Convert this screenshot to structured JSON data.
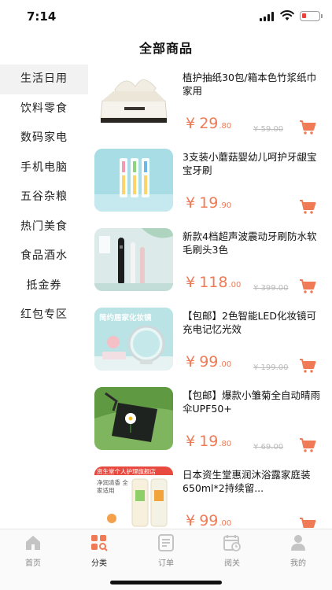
{
  "status_bar": {
    "time": "7:14",
    "battery_color": "#e8423f"
  },
  "nav": {
    "title": "全部商品"
  },
  "sidebar": {
    "items": [
      {
        "label": "生活日用",
        "active": true
      },
      {
        "label": "饮料零食"
      },
      {
        "label": "数码家电"
      },
      {
        "label": "手机电脑"
      },
      {
        "label": "五谷杂粮"
      },
      {
        "label": "热门美食"
      },
      {
        "label": "食品酒水"
      },
      {
        "label": "抵金券"
      },
      {
        "label": "红包专区"
      }
    ]
  },
  "products": [
    {
      "name": "植护抽纸30包/箱本色竹浆纸巾家用",
      "price_symbol": "¥",
      "price_int": "29",
      "price_dec": ".80",
      "old_price": "¥ 59.00",
      "image": "tissue-box-image"
    },
    {
      "name": "3支装小蘑菇婴幼儿呵护牙龈宝宝牙刷",
      "price_symbol": "¥",
      "price_int": "19",
      "price_dec": ".90",
      "old_price": "",
      "image": "baby-toothbrush-image"
    },
    {
      "name": "新款4档超声波震动牙刷防水软毛刷头3色",
      "price_symbol": "¥",
      "price_int": "118",
      "price_dec": ".00",
      "old_price": "¥ 399.00",
      "image": "electric-toothbrush-image"
    },
    {
      "name": "【包邮】2色智能LED化妆镜可充电记忆光效",
      "price_symbol": "¥",
      "price_int": "99",
      "price_dec": ".00",
      "old_price": "¥ 199.00",
      "image": "led-mirror-image",
      "thumb_caption": "简约居家化妆镜"
    },
    {
      "name": "【包邮】爆款小雏菊全自动晴雨伞UPF50+",
      "price_symbol": "¥",
      "price_int": "19",
      "price_dec": ".80",
      "old_price": "¥ 69.00",
      "image": "daisy-umbrella-image"
    },
    {
      "name": "日本资生堂惠润沐浴露家庭装650ml*2持续留...",
      "price_symbol": "¥",
      "price_int": "99",
      "price_dec": ".00",
      "old_price": "",
      "image": "shower-gel-image",
      "thumb_caption": "资生堂个人护理旗舰店",
      "thumb_sub": "净润清香 全家适用"
    }
  ],
  "tabs": [
    {
      "label": "首页",
      "icon": "home-icon"
    },
    {
      "label": "分类",
      "icon": "category-icon",
      "active": true
    },
    {
      "label": "订单",
      "icon": "order-icon"
    },
    {
      "label": "阅关",
      "icon": "calendar-icon"
    },
    {
      "label": "我的",
      "icon": "profile-icon"
    }
  ],
  "colors": {
    "price": "#f07a55",
    "accent": "#f07a55",
    "active_bg": "#f2f2f2"
  }
}
